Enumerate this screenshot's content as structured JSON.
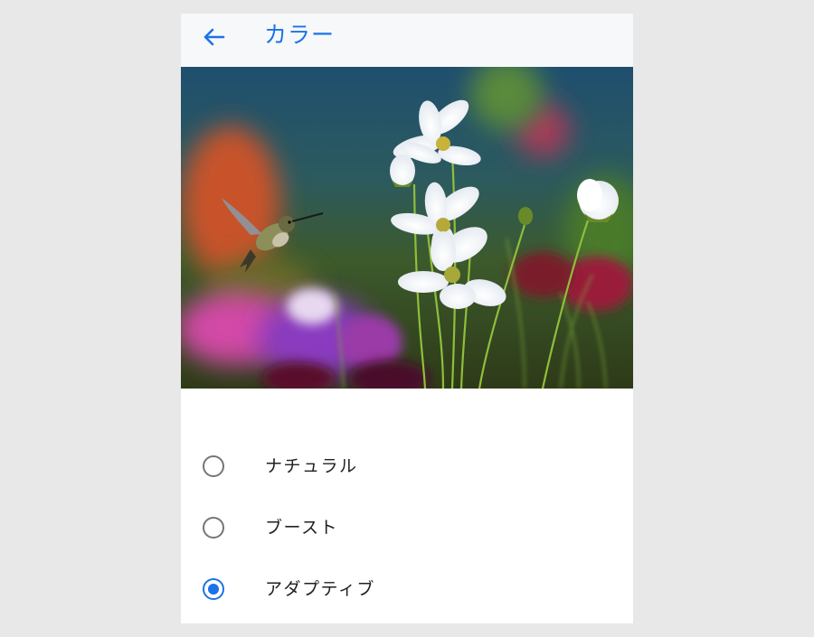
{
  "header": {
    "title": "カラー",
    "back_icon": "arrow-left-icon"
  },
  "colors": {
    "accent": "#1a73e8",
    "radio_off": "#757575",
    "text": "#202124",
    "appbar_bg": "#f7f8fa",
    "page_bg": "#e8e8e8"
  },
  "preview": {
    "subject": "hummingbird-and-cosmos-flowers"
  },
  "color_modes": {
    "options": [
      {
        "label": "ナチュラル",
        "selected": false
      },
      {
        "label": "ブースト",
        "selected": false
      },
      {
        "label": "アダプティブ",
        "selected": true
      }
    ]
  }
}
